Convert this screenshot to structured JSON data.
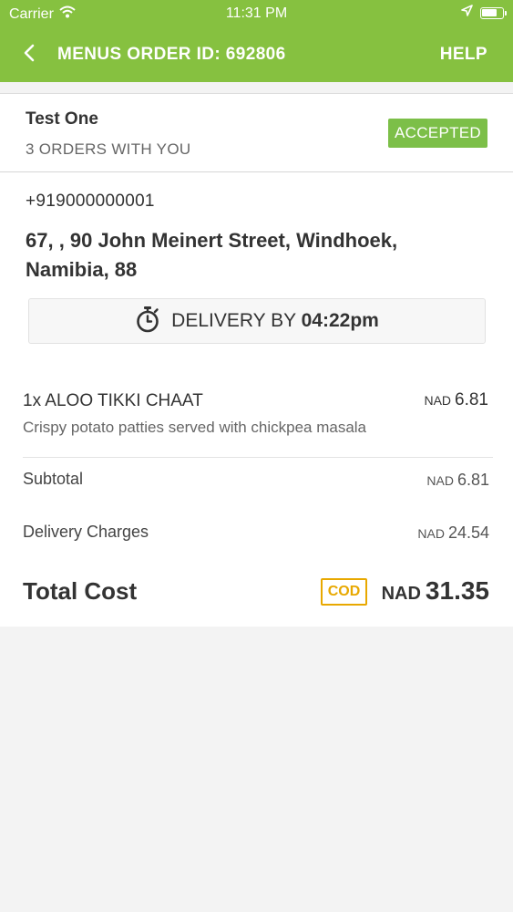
{
  "status_bar": {
    "carrier": "Carrier",
    "time": "11:31 PM",
    "battery_level": 0.75
  },
  "nav": {
    "title": "MENUS ORDER ID: 692806",
    "help": "HELP"
  },
  "customer": {
    "name": "Test One",
    "orders": "3 ORDERS WITH YOU",
    "status": "ACCEPTED"
  },
  "contact": {
    "phone": "+919000000001",
    "address": "67, , 90 John Meinert Street, Windhoek, Namibia,  88"
  },
  "delivery": {
    "label": "DELIVERY BY",
    "time": "04:22pm"
  },
  "item": {
    "name": "1x ALOO TIKKI CHAAT",
    "currency": "NAD",
    "price": "6.81",
    "description": "Crispy potato patties served with chickpea masala"
  },
  "summary": {
    "subtotal_label": "Subtotal",
    "subtotal_currency": "NAD",
    "subtotal_value": "6.81",
    "delivery_label": "Delivery Charges",
    "delivery_currency": "NAD",
    "delivery_value": "24.54",
    "total_label": "Total Cost",
    "payment_method": "COD",
    "total_currency": "NAD",
    "total_value": "31.35"
  },
  "colors": {
    "brand": "#86c140",
    "accepted": "#7cbf48",
    "cod": "#e8a800"
  }
}
